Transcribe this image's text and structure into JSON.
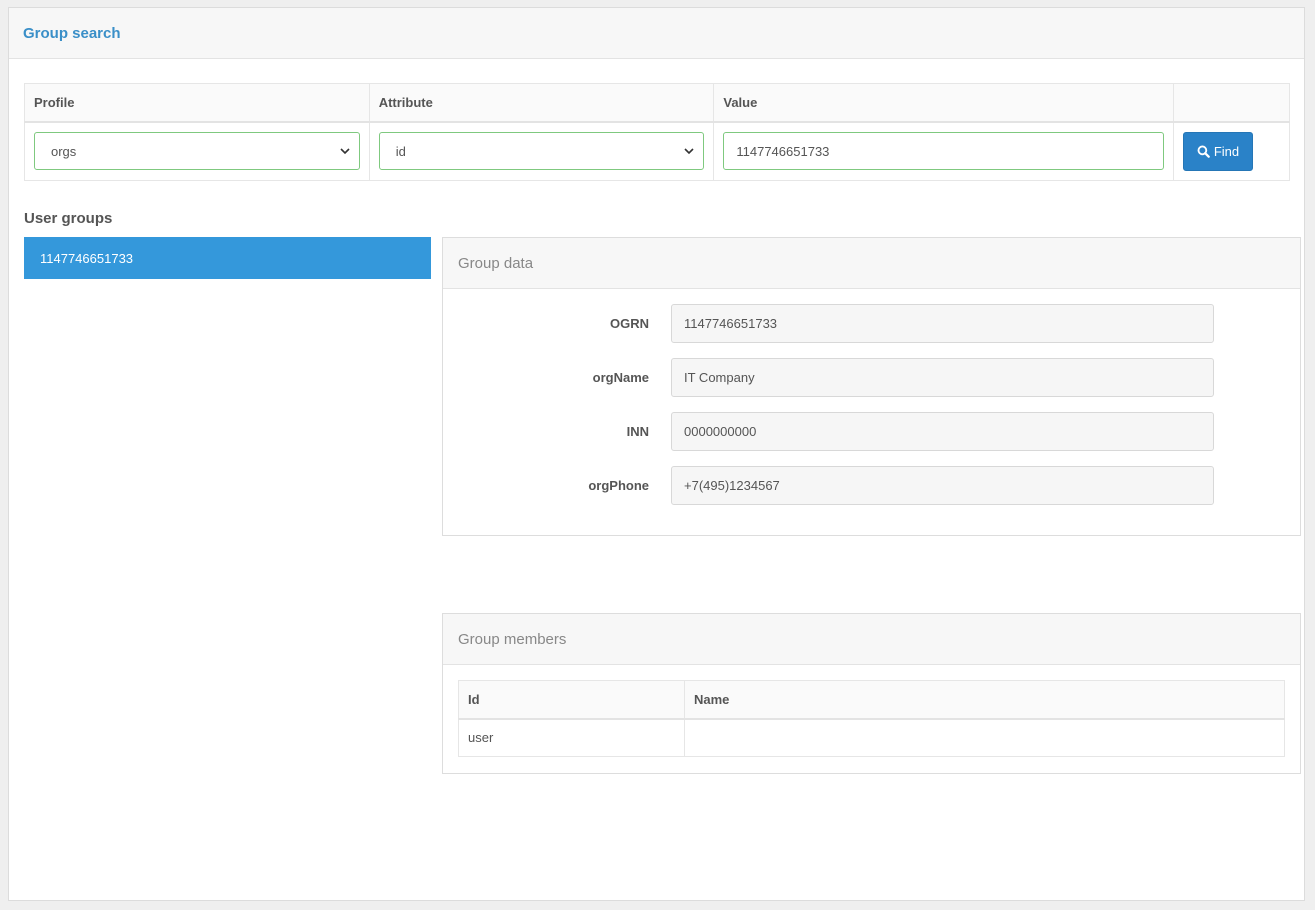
{
  "panel": {
    "title": "Group search"
  },
  "search": {
    "headers": {
      "profile": "Profile",
      "attribute": "Attribute",
      "value": "Value"
    },
    "profile_selected": "orgs",
    "attribute_selected": "id",
    "value": "1147746651733",
    "find_label": "Find"
  },
  "user_groups": {
    "title": "User groups",
    "items": [
      "1147746651733"
    ]
  },
  "group_data": {
    "title": "Group data",
    "fields": [
      {
        "label": "OGRN",
        "value": "1147746651733"
      },
      {
        "label": "orgName",
        "value": "IT Company"
      },
      {
        "label": "INN",
        "value": "0000000000"
      },
      {
        "label": "orgPhone",
        "value": "+7(495)1234567"
      }
    ]
  },
  "group_members": {
    "title": "Group members",
    "columns": [
      "Id",
      "Name"
    ],
    "rows": [
      [
        "user",
        ""
      ]
    ]
  },
  "colors": {
    "accent": "#3a8fc8",
    "selected_item": "#3498db",
    "button": "#2a82c8",
    "input_border": "#7fc97f"
  }
}
